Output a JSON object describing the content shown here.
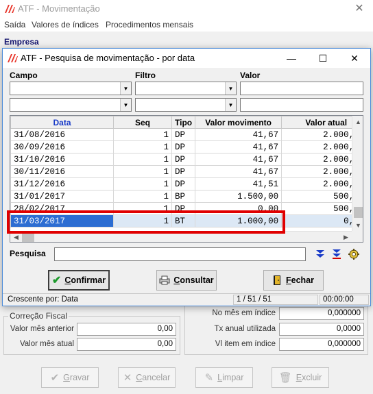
{
  "main": {
    "title": "ATF - Movimentação",
    "menu": [
      "Saída",
      "Valores de índices",
      "Procedimentos mensais"
    ],
    "empresa_label": "Empresa",
    "correcao_fiscal": {
      "legend": "Correção Fiscal",
      "rows": [
        {
          "label": "Valor mês anterior",
          "value": "0,00"
        },
        {
          "label": "Valor mês atual",
          "value": "0,00"
        }
      ]
    },
    "indices": [
      {
        "label": "No mês em índice",
        "value": "0,000000"
      },
      {
        "label": "Tx anual utilizada",
        "value": "0,0000"
      },
      {
        "label": "Vl item em índice",
        "value": "0,000000"
      }
    ],
    "buttons": {
      "gravar": {
        "label": "Gravar",
        "mnemonic": "G",
        "rest": "ravar"
      },
      "cancelar": {
        "label": "Cancelar",
        "mnemonic": "C",
        "rest": "ancelar"
      },
      "limpar": {
        "label": "Limpar",
        "mnemonic": "L",
        "rest": "impar"
      },
      "excluir": {
        "label": "Excluir",
        "mnemonic": "E",
        "rest": "xcluir"
      }
    }
  },
  "dialog": {
    "title": "ATF - Pesquisa de movimentação - por data",
    "filter_headers": {
      "campo": "Campo",
      "filtro": "Filtro",
      "valor": "Valor"
    },
    "filter_rows": [
      {
        "campo": "",
        "filtro": "",
        "valor": ""
      },
      {
        "campo": "",
        "filtro": "",
        "valor": ""
      }
    ],
    "grid": {
      "columns": [
        "Data",
        "Seq",
        "Tipo",
        "Valor movimento",
        "Valor atual"
      ],
      "sorted_column": "Data",
      "rows": [
        {
          "data": "31/08/2016",
          "seq": "1",
          "tipo": "DP",
          "valor_mov": "41,67",
          "valor_atual": "2.000,"
        },
        {
          "data": "30/09/2016",
          "seq": "1",
          "tipo": "DP",
          "valor_mov": "41,67",
          "valor_atual": "2.000,"
        },
        {
          "data": "31/10/2016",
          "seq": "1",
          "tipo": "DP",
          "valor_mov": "41,67",
          "valor_atual": "2.000,"
        },
        {
          "data": "30/11/2016",
          "seq": "1",
          "tipo": "DP",
          "valor_mov": "41,67",
          "valor_atual": "2.000,"
        },
        {
          "data": "31/12/2016",
          "seq": "1",
          "tipo": "DP",
          "valor_mov": "41,51",
          "valor_atual": "2.000,"
        },
        {
          "data": "31/01/2017",
          "seq": "1",
          "tipo": "BP",
          "valor_mov": "1.500,00",
          "valor_atual": "500,"
        },
        {
          "data": "28/02/2017",
          "seq": "1",
          "tipo": "DP",
          "valor_mov": "0,00",
          "valor_atual": "500,"
        },
        {
          "data": "31/03/2017",
          "seq": "1",
          "tipo": "BT",
          "valor_mov": "1.000,00",
          "valor_atual": "0,"
        }
      ],
      "selected_row": 7
    },
    "search_label": "Pesquisa",
    "search_value": "",
    "buttons": {
      "confirmar": {
        "label": "Confirmar",
        "mnemonic": "C",
        "rest": "onfirmar"
      },
      "consultar": {
        "label": "Consultar",
        "mnemonic": "C",
        "rest": "onsultar"
      },
      "fechar": {
        "label": "Fechar",
        "mnemonic": "F",
        "rest": "echar"
      }
    },
    "status": {
      "order": "Crescente por: Data",
      "records": "1 / 51 / 51",
      "time": "00:00:00"
    }
  },
  "colors": {
    "accent_blue": "#1a3cc8",
    "selection": "#2c6dd2",
    "highlight_red": "#e00000",
    "empresa_navy": "#14146e"
  },
  "icons": [
    "app-logo-icon",
    "close-icon",
    "minimize-icon",
    "maximize-icon",
    "dropdown-arrow-icon",
    "scroll-up-icon",
    "scroll-down-icon",
    "scroll-left-icon",
    "scroll-right-icon",
    "next-record-icon",
    "last-record-icon",
    "settings-icon",
    "checkmark-icon",
    "print-preview-icon",
    "exit-door-icon"
  ]
}
